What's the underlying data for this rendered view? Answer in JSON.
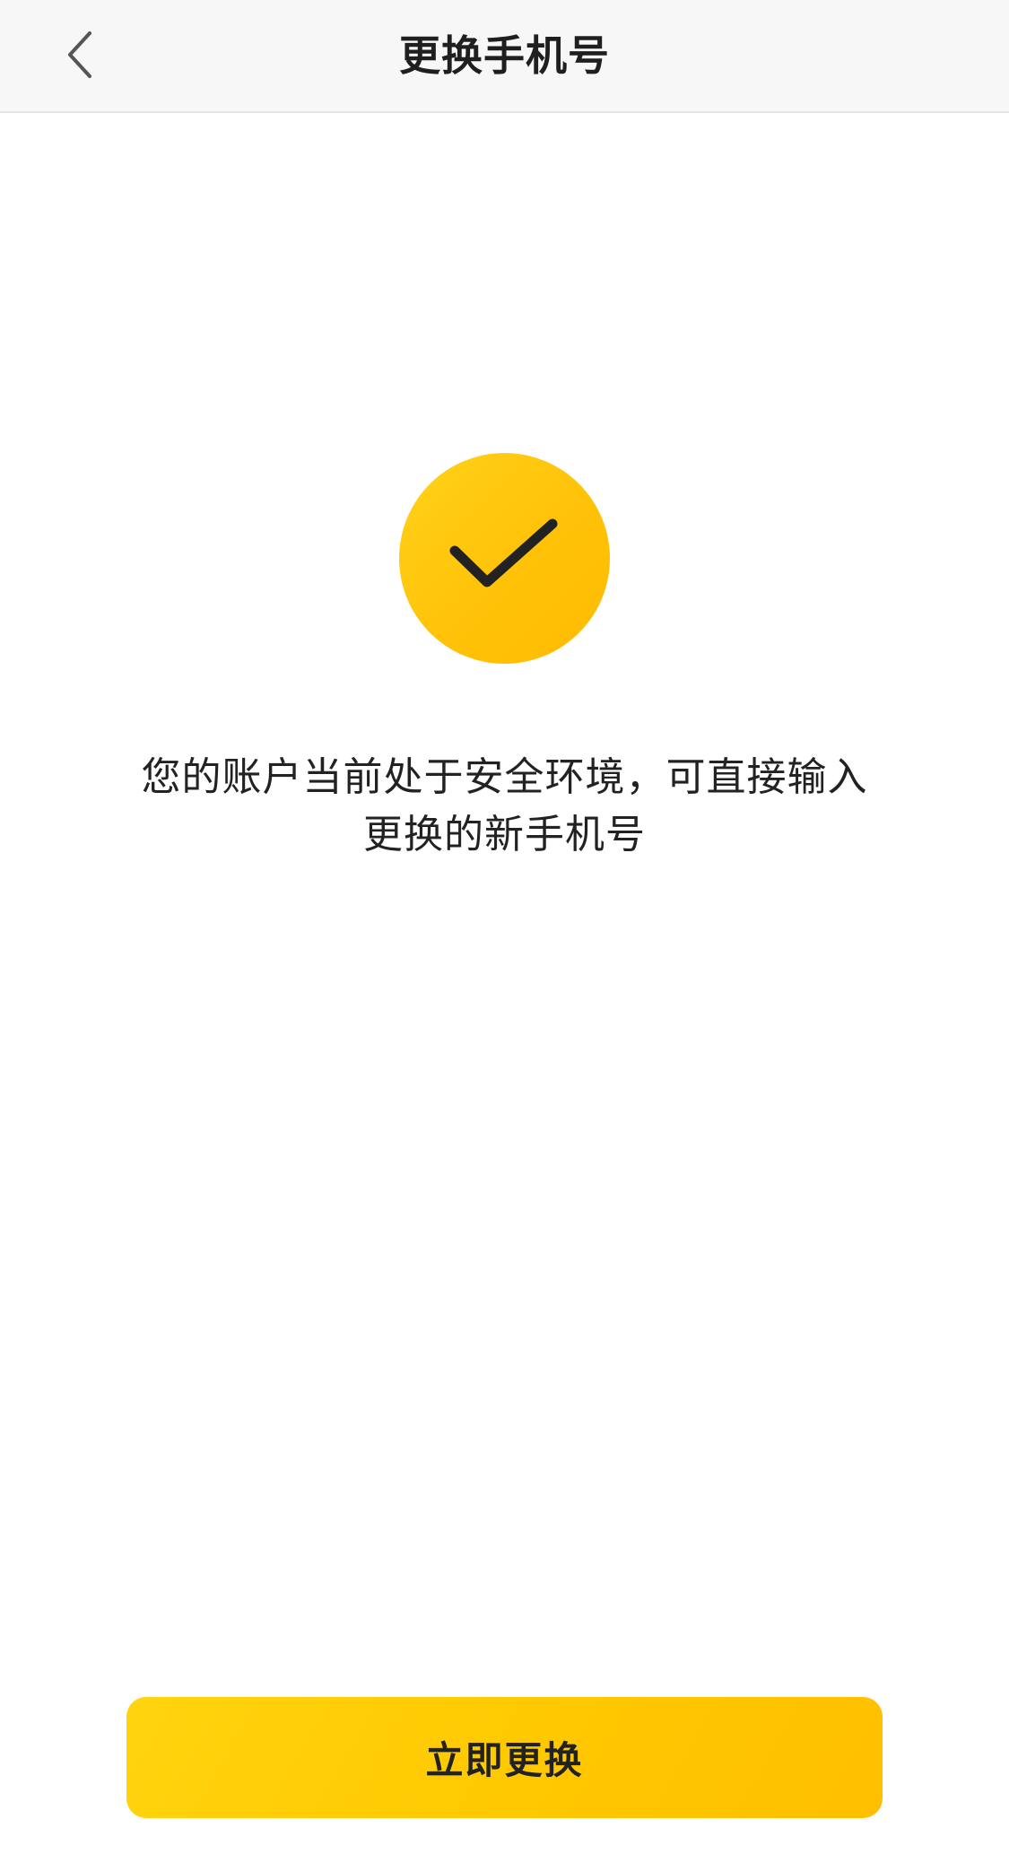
{
  "header": {
    "title": "更换手机号",
    "back_icon": "chevron-left-icon"
  },
  "main": {
    "status_icon": "checkmark-icon",
    "status_color": "#ffc70a",
    "message_line1": "您的账户当前处于安全环境，可直接输入",
    "message_line2": "更换的新手机号"
  },
  "footer": {
    "action_label": "立即更换",
    "action_color": "#ffc800"
  }
}
